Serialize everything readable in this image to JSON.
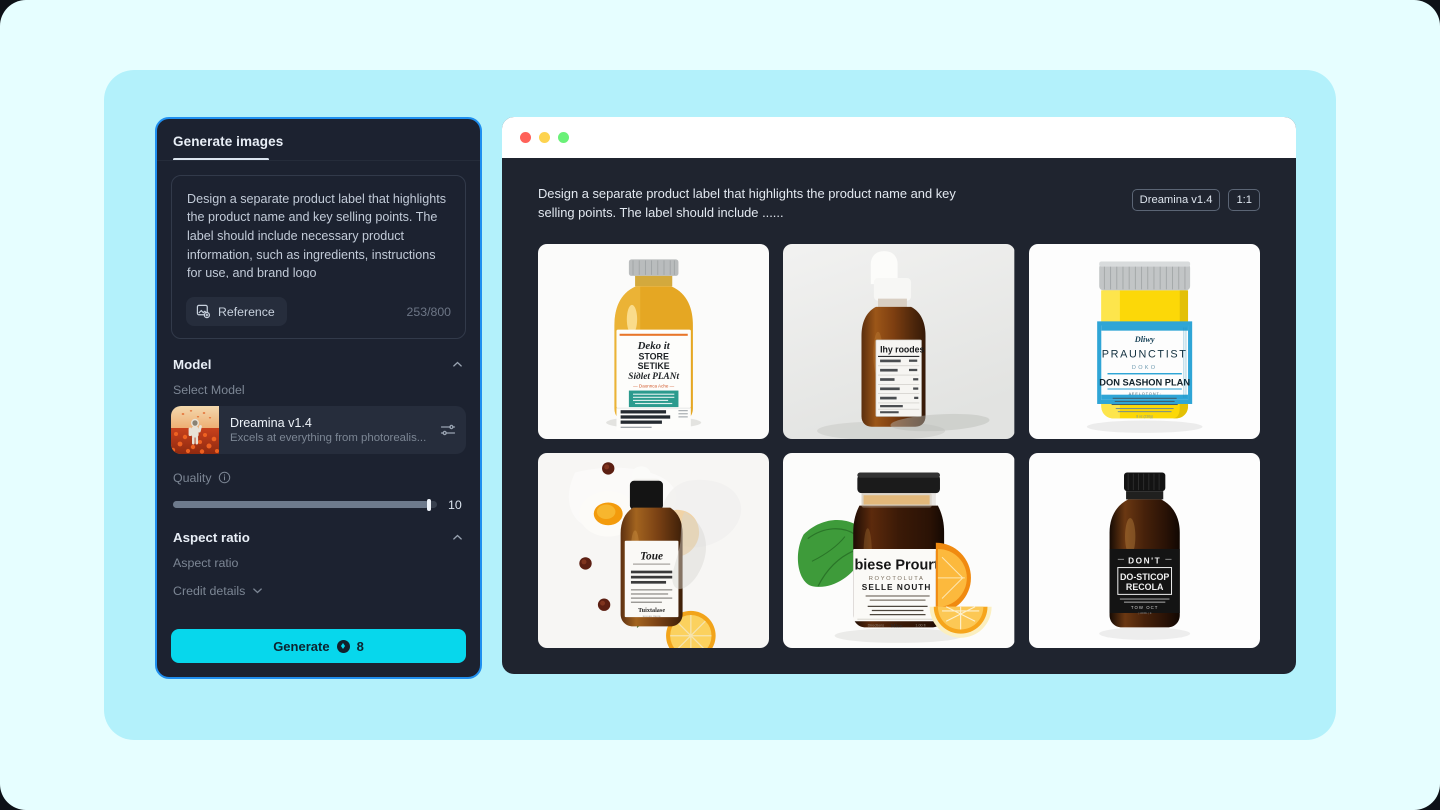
{
  "theme": {
    "page_bg": "#e6feff",
    "stage_bg": "#b3f1fb",
    "panel_bg": "#1c2230",
    "panel_border": "#1f8fef",
    "accent": "#07d7ec",
    "preview_bg": "#1f242f"
  },
  "left_panel": {
    "tab": {
      "label": "Generate images"
    },
    "prompt": {
      "value": "Design a separate product label that highlights the product name and key selling points. The label should include necessary product information, such as ingredients, instructions for use, and brand logo",
      "reference_button": "Reference",
      "reference_icon": "image-plus-icon",
      "char_count": "253/800"
    },
    "model_section": {
      "title": "Model",
      "collapse_icon": "chevron-up-icon",
      "select_label": "Select Model",
      "model": {
        "name": "Dreamina v1.4",
        "description": "Excels at everything from photorealis...",
        "settings_icon": "sliders-icon",
        "thumbnail": "astronaut-in-orange-flower-field"
      }
    },
    "quality": {
      "label": "Quality",
      "info_icon": "info-circle-icon",
      "value": "10",
      "percent": 97
    },
    "aspect_section": {
      "title": "Aspect ratio",
      "collapse_icon": "chevron-up-icon",
      "sub_label": "Aspect ratio"
    },
    "credit_details": {
      "label": "Credit details",
      "chevron_icon": "chevron-down-icon"
    },
    "generate": {
      "label": "Generate",
      "coin_icon": "credit-coin-icon",
      "credits": "8"
    }
  },
  "preview": {
    "window_dots": [
      {
        "name": "close-dot",
        "color": "#ff6159"
      },
      {
        "name": "minimize-dot",
        "color": "#fdd34f"
      },
      {
        "name": "maximize-dot",
        "color": "#6af178"
      }
    ],
    "prompt": "Design a separate product label that highlights the product name and key selling points. The label should include ......",
    "badges": [
      {
        "label": "Dreamina v1.4"
      },
      {
        "label": "1:1"
      }
    ],
    "results": [
      {
        "name": "result-1",
        "caption": "Amber oil bottle with white vintage label on white background",
        "label_lines": [
          "Deko it",
          "STORE",
          "SETIKE",
          "Siдlet PLANt"
        ]
      },
      {
        "name": "result-2",
        "caption": "Amber dropper bottle with white cap and nutrition-style label",
        "label_lines": [
          "Ihy roodes"
        ]
      },
      {
        "name": "result-3",
        "caption": "Yellow jar with silver lid and blue label",
        "label_lines": [
          "PRAUNCTIST",
          "DOKO",
          "DON SASHON PLAN"
        ]
      },
      {
        "name": "result-4",
        "caption": "Flat-lay serum bottle with citrus and berries",
        "label_lines": [
          "Toue"
        ]
      },
      {
        "name": "result-5",
        "caption": "Dark jar with green leaf and orange slices",
        "label_lines": [
          "biese Prourt",
          "ROYOTOLUTA",
          "SELLE NOUTH"
        ]
      },
      {
        "name": "result-6",
        "caption": "Dark bottle with black label on white background",
        "label_lines": [
          "DON'T",
          "DO-STICOP",
          "RECOLA"
        ]
      }
    ]
  }
}
